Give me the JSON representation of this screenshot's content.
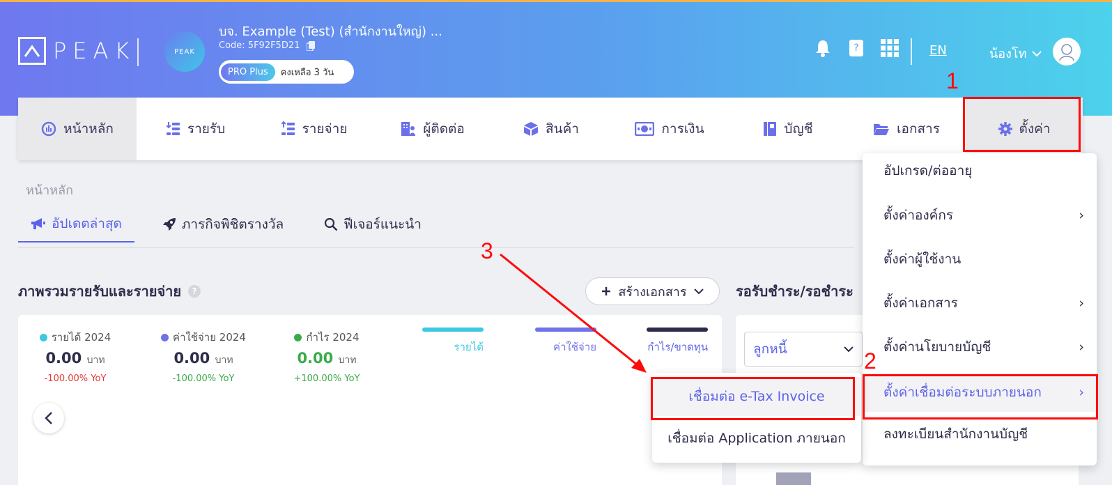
{
  "header": {
    "logo_text": "PEAK",
    "org_avatar_text": "PEAK",
    "org_name": "บจ. Example (Test) (สำนักงานใหญ่) ...",
    "org_code": "Code: 5F92F5D21",
    "plan": "PRO Plus",
    "plan_remaining": "คงเหลือ 3 วัน",
    "lang": "EN",
    "user_name": "น้องโท",
    "icons": [
      "bell-icon",
      "book-icon",
      "apps-grid-icon",
      "copy-icon",
      "chevron-down-icon"
    ]
  },
  "nav": {
    "items": [
      {
        "label": "หน้าหลัก",
        "icon": "dashboard-icon"
      },
      {
        "label": "รายรับ",
        "icon": "income-icon"
      },
      {
        "label": "รายจ่าย",
        "icon": "expense-icon"
      },
      {
        "label": "ผู้ติดต่อ",
        "icon": "contacts-icon"
      },
      {
        "label": "สินค้า",
        "icon": "box-icon"
      },
      {
        "label": "การเงิน",
        "icon": "money-icon"
      },
      {
        "label": "บัญชี",
        "icon": "ledger-icon"
      },
      {
        "label": "เอกสาร",
        "icon": "folder-icon"
      },
      {
        "label": "ตั้งค่า",
        "icon": "gear-icon"
      }
    ]
  },
  "breadcrumb": "หน้าหลัก",
  "subtabs": [
    {
      "label": "อัปเดตล่าสุด",
      "icon": "megaphone-icon"
    },
    {
      "label": "ภารกิจพิชิตรางวัล",
      "icon": "rocket-icon"
    },
    {
      "label": "ฟีเจอร์แนะนำ",
      "icon": "search-icon"
    }
  ],
  "overview": {
    "title": "ภาพรวมรายรับและรายจ่าย",
    "create_button": "สร้างเอกสาร",
    "stats": [
      {
        "label": "รายได้ 2024",
        "value": "0.00",
        "unit": "บาท",
        "yoy": "-100.00% YoY",
        "dot_color": "#3ec8e0",
        "value_color": "#2d2d4a",
        "yoy_color": "#e53935"
      },
      {
        "label": "ค่าใช้จ่าย 2024",
        "value": "0.00",
        "unit": "บาท",
        "yoy": "-100.00% YoY",
        "dot_color": "#6f72e8",
        "value_color": "#2d2d4a",
        "yoy_color": "#3bab4a"
      },
      {
        "label": "กำไร 2024",
        "value": "0.00",
        "unit": "บาท",
        "yoy": "+100.00% YoY",
        "dot_color": "#3bab4a",
        "value_color": "#3bab4a",
        "yoy_color": "#3bab4a"
      }
    ],
    "legend": [
      {
        "label": "รายได้",
        "color": "#3ec8e0"
      },
      {
        "label": "ค่าใช้จ่าย",
        "color": "#6f72e8"
      },
      {
        "label": "กำไร/ขาดทุน",
        "color": "#2d2d4a"
      }
    ]
  },
  "receivables": {
    "title": "รอรับชำระ/รอชำระ",
    "select_value": "ลูกหนี้"
  },
  "settings_menu": {
    "items": [
      {
        "label": "อัปเกรด/ต่ออายุ",
        "has_sub": false
      },
      {
        "label": "ตั้งค่าองค์กร",
        "has_sub": true
      },
      {
        "label": "ตั้งค่าผู้ใช้งาน",
        "has_sub": false
      },
      {
        "label": "ตั้งค่าเอกสาร",
        "has_sub": true
      },
      {
        "label": "ตั้งค่านโยบายบัญชี",
        "has_sub": true
      },
      {
        "label": "ตั้งค่าเชื่อมต่อระบบภายนอก",
        "has_sub": true
      },
      {
        "label": "ลงทะเบียนสำนักงานบัญชี",
        "has_sub": false
      }
    ],
    "chevron": "›"
  },
  "integration_submenu": {
    "items": [
      "เชื่อมต่อ e-Tax Invoice",
      "เชื่อมต่อ Application ภายนอก"
    ]
  },
  "annotations": {
    "step1": "1",
    "step2": "2",
    "step3": "3",
    "color": "#ff0a0a"
  }
}
